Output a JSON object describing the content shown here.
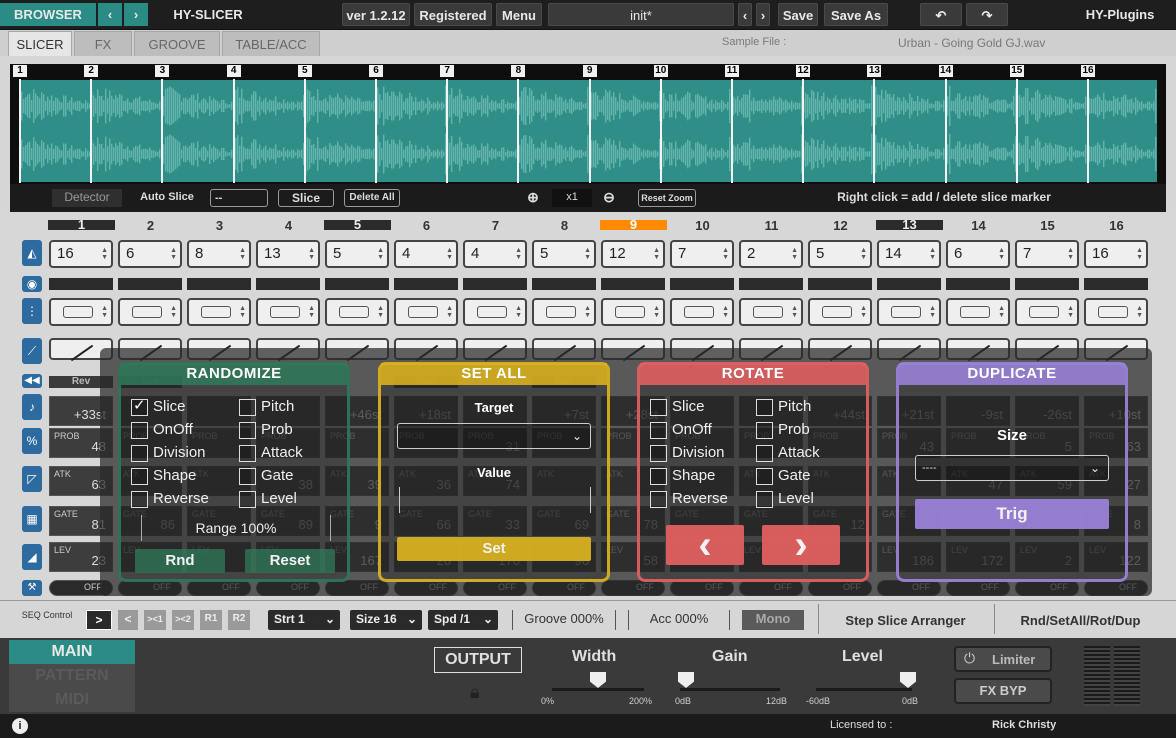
{
  "topbar": {
    "browser": "BROWSER",
    "plugin_name": "HY-SLICER",
    "version": "ver 1.2.12",
    "registered": "Registered",
    "menu": "Menu",
    "preset": "init*",
    "save": "Save",
    "save_as": "Save As",
    "vendor": "HY-Plugins"
  },
  "tabs": [
    "SLICER",
    "FX",
    "GROOVE",
    "TABLE/ACC"
  ],
  "sample_file_label": "Sample File :",
  "sample_file_name": "Urban - Going Gold GJ.wav",
  "waveform": {
    "markers": [
      "1",
      "2",
      "3",
      "4",
      "5",
      "6",
      "7",
      "8",
      "9",
      "10",
      "11",
      "12",
      "13",
      "14",
      "15",
      "16"
    ],
    "detector": "Detector",
    "auto_slice": "Auto Slice",
    "auto_slice_value": "--",
    "slice": "Slice",
    "delete_all": "Delete All",
    "zoom": "x1",
    "reset_zoom": "Reset Zoom",
    "hint": "Right click = add / delete slice marker"
  },
  "grid": {
    "columns": [
      "1",
      "2",
      "3",
      "4",
      "5",
      "6",
      "7",
      "8",
      "9",
      "10",
      "11",
      "12",
      "13",
      "14",
      "15",
      "16"
    ],
    "highlighted_columns": [
      "1",
      "5",
      "13"
    ],
    "active_column": "9",
    "slice_values": [
      "16",
      "6",
      "8",
      "13",
      "5",
      "4",
      "4",
      "5",
      "12",
      "7",
      "2",
      "5",
      "14",
      "6",
      "7",
      "16"
    ],
    "pitch_values": [
      "+33st",
      "",
      "",
      "",
      "+46st",
      "+18st",
      "",
      "+7st",
      "+28st",
      "",
      "",
      "+44st",
      "+21st",
      "-9st",
      "-26st",
      "+10st"
    ],
    "prob_values": [
      "48",
      "",
      "",
      "",
      "",
      "",
      "31",
      "",
      "",
      "",
      "",
      "",
      "43",
      "",
      "5",
      "63"
    ],
    "atk_values": [
      "63",
      "",
      "",
      "38",
      "39",
      "36",
      "74",
      "",
      "",
      "",
      "",
      "",
      "",
      "47",
      "59",
      "27"
    ],
    "gate_values": [
      "81",
      "86",
      "",
      "89",
      "9",
      "66",
      "33",
      "69",
      "78",
      "",
      "",
      "12",
      "43",
      "60",
      "41",
      "8"
    ],
    "lev_values": [
      "23",
      "",
      "",
      "",
      "167",
      "26",
      "176",
      "96",
      "58",
      "",
      "",
      "",
      "186",
      "172",
      "2",
      "122"
    ],
    "row_labels": [
      "Rev",
      "Rev",
      "Rev",
      "Rev"
    ],
    "off_label": "OFF",
    "strip_labels": {
      "prob": "PROB",
      "atk": "ATK",
      "gate": "GATE",
      "lev": "LEV"
    }
  },
  "panels": {
    "randomize": {
      "title": "RANDOMIZE",
      "options": [
        "Slice",
        "OnOff",
        "Division",
        "Shape",
        "Reverse",
        "Pitch",
        "Prob",
        "Attack",
        "Gate",
        "Level"
      ],
      "range": "Range 100%",
      "rnd": "Rnd",
      "reset": "Reset"
    },
    "setall": {
      "title": "SET ALL",
      "target": "Target",
      "value": "Value",
      "set": "Set"
    },
    "rotate": {
      "title": "ROTATE",
      "options": [
        "Slice",
        "OnOff",
        "Division",
        "Shape",
        "Reverse",
        "Pitch",
        "Prob",
        "Attack",
        "Gate",
        "Level"
      ]
    },
    "duplicate": {
      "title": "DUPLICATE",
      "size": "Size",
      "size_value": "----",
      "trig": "Trig"
    }
  },
  "seqbar": {
    "seq_control": "SEQ Control",
    "buttons": [
      ">",
      "<",
      "><1",
      "><2",
      "R1",
      "R2"
    ],
    "start": "Strt 1",
    "size": "Size 16",
    "speed": "Spd /1",
    "groove": "Groove 000%",
    "acc": "Acc 000%",
    "mono": "Mono",
    "step_slice_arranger": "Step Slice Arranger",
    "rnd_set_rot_dup": "Rnd/SetAll/Rot/Dup"
  },
  "bottom": {
    "nav": [
      "MAIN",
      "PATTERN",
      "MIDI"
    ],
    "output": "OUTPUT",
    "width": {
      "label": "Width",
      "min": "0%",
      "max": "200%"
    },
    "gain": {
      "label": "Gain",
      "min": "0dB",
      "max": "12dB"
    },
    "level": {
      "label": "Level",
      "min": "-60dB",
      "max": "0dB"
    },
    "limiter": "Limiter",
    "fx_byp": "FX BYP"
  },
  "status": {
    "licensed_to": "Licensed to :",
    "user": "Rick Christy"
  },
  "colors": {
    "teal": "#2a8c85",
    "randomize": "#2f7a5a",
    "setall": "#d8b020",
    "rotate": "#e06060",
    "duplicate": "#9a82d8",
    "active_step": "#ff8a00"
  }
}
